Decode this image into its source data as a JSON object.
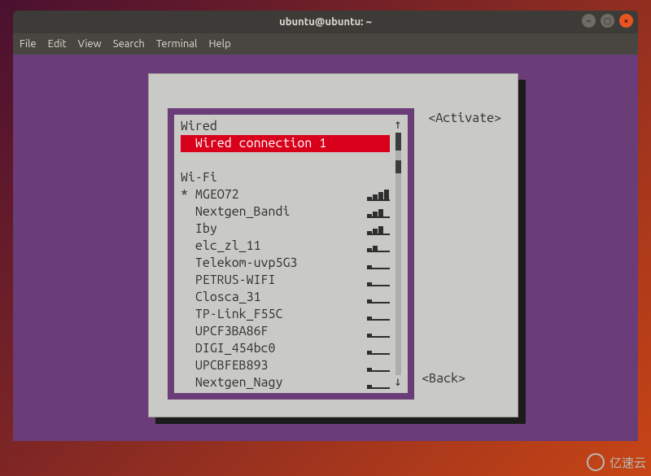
{
  "window": {
    "title": "ubuntu@ubuntu: ~",
    "menu": [
      "File",
      "Edit",
      "View",
      "Search",
      "Terminal",
      "Help"
    ]
  },
  "nmtui": {
    "sections": {
      "wired_label": "Wired",
      "wifi_label": "Wi-Fi"
    },
    "wired_items": [
      {
        "label": "  Wired connection 1",
        "selected": true
      }
    ],
    "wifi_items": [
      {
        "prefix": "* ",
        "label": "MGEO72",
        "signal": 4
      },
      {
        "prefix": "  ",
        "label": "Nextgen_Bandi",
        "signal": 3
      },
      {
        "prefix": "  ",
        "label": "Iby",
        "signal": 3
      },
      {
        "prefix": "  ",
        "label": "elc_zl_11",
        "signal": 2
      },
      {
        "prefix": "  ",
        "label": "Telekom-uvp5G3",
        "signal": 1
      },
      {
        "prefix": "  ",
        "label": "PETRUS-WIFI",
        "signal": 1
      },
      {
        "prefix": "  ",
        "label": "Closca_31",
        "signal": 1
      },
      {
        "prefix": "  ",
        "label": "TP-Link_F55C",
        "signal": 1
      },
      {
        "prefix": "  ",
        "label": "UPCF3BA86F",
        "signal": 1
      },
      {
        "prefix": "  ",
        "label": "DIGI_454bc0",
        "signal": 1
      },
      {
        "prefix": "  ",
        "label": "UPCBFEB893",
        "signal": 1
      },
      {
        "prefix": "  ",
        "label": "Nextgen_Nagy",
        "signal": 1
      }
    ],
    "buttons": {
      "activate": "<Activate>",
      "back": "<Back>"
    },
    "scroll": {
      "up_arrow": "↑",
      "down_arrow": "↓"
    }
  },
  "watermark": {
    "text": "亿速云"
  }
}
